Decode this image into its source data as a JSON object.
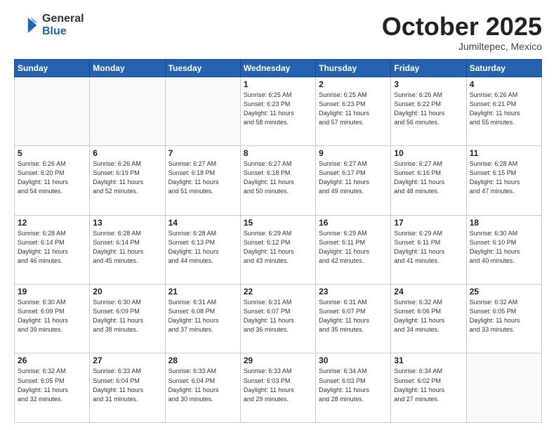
{
  "header": {
    "logo_general": "General",
    "logo_blue": "Blue",
    "month": "October 2025",
    "location": "Jumiltepec, Mexico"
  },
  "days_of_week": [
    "Sunday",
    "Monday",
    "Tuesday",
    "Wednesday",
    "Thursday",
    "Friday",
    "Saturday"
  ],
  "weeks": [
    [
      {
        "day": "",
        "info": ""
      },
      {
        "day": "",
        "info": ""
      },
      {
        "day": "",
        "info": ""
      },
      {
        "day": "1",
        "info": "Sunrise: 6:25 AM\nSunset: 6:23 PM\nDaylight: 11 hours\nand 58 minutes."
      },
      {
        "day": "2",
        "info": "Sunrise: 6:25 AM\nSunset: 6:23 PM\nDaylight: 11 hours\nand 57 minutes."
      },
      {
        "day": "3",
        "info": "Sunrise: 6:26 AM\nSunset: 6:22 PM\nDaylight: 11 hours\nand 56 minutes."
      },
      {
        "day": "4",
        "info": "Sunrise: 6:26 AM\nSunset: 6:21 PM\nDaylight: 11 hours\nand 55 minutes."
      }
    ],
    [
      {
        "day": "5",
        "info": "Sunrise: 6:26 AM\nSunset: 6:20 PM\nDaylight: 11 hours\nand 54 minutes."
      },
      {
        "day": "6",
        "info": "Sunrise: 6:26 AM\nSunset: 6:19 PM\nDaylight: 11 hours\nand 52 minutes."
      },
      {
        "day": "7",
        "info": "Sunrise: 6:27 AM\nSunset: 6:18 PM\nDaylight: 11 hours\nand 51 minutes."
      },
      {
        "day": "8",
        "info": "Sunrise: 6:27 AM\nSunset: 6:18 PM\nDaylight: 11 hours\nand 50 minutes."
      },
      {
        "day": "9",
        "info": "Sunrise: 6:27 AM\nSunset: 6:17 PM\nDaylight: 11 hours\nand 49 minutes."
      },
      {
        "day": "10",
        "info": "Sunrise: 6:27 AM\nSunset: 6:16 PM\nDaylight: 11 hours\nand 48 minutes."
      },
      {
        "day": "11",
        "info": "Sunrise: 6:28 AM\nSunset: 6:15 PM\nDaylight: 11 hours\nand 47 minutes."
      }
    ],
    [
      {
        "day": "12",
        "info": "Sunrise: 6:28 AM\nSunset: 6:14 PM\nDaylight: 11 hours\nand 46 minutes."
      },
      {
        "day": "13",
        "info": "Sunrise: 6:28 AM\nSunset: 6:14 PM\nDaylight: 11 hours\nand 45 minutes."
      },
      {
        "day": "14",
        "info": "Sunrise: 6:28 AM\nSunset: 6:13 PM\nDaylight: 11 hours\nand 44 minutes."
      },
      {
        "day": "15",
        "info": "Sunrise: 6:29 AM\nSunset: 6:12 PM\nDaylight: 11 hours\nand 43 minutes."
      },
      {
        "day": "16",
        "info": "Sunrise: 6:29 AM\nSunset: 6:11 PM\nDaylight: 11 hours\nand 42 minutes."
      },
      {
        "day": "17",
        "info": "Sunrise: 6:29 AM\nSunset: 6:11 PM\nDaylight: 11 hours\nand 41 minutes."
      },
      {
        "day": "18",
        "info": "Sunrise: 6:30 AM\nSunset: 6:10 PM\nDaylight: 11 hours\nand 40 minutes."
      }
    ],
    [
      {
        "day": "19",
        "info": "Sunrise: 6:30 AM\nSunset: 6:09 PM\nDaylight: 11 hours\nand 39 minutes."
      },
      {
        "day": "20",
        "info": "Sunrise: 6:30 AM\nSunset: 6:09 PM\nDaylight: 11 hours\nand 38 minutes."
      },
      {
        "day": "21",
        "info": "Sunrise: 6:31 AM\nSunset: 6:08 PM\nDaylight: 11 hours\nand 37 minutes."
      },
      {
        "day": "22",
        "info": "Sunrise: 6:31 AM\nSunset: 6:07 PM\nDaylight: 11 hours\nand 36 minutes."
      },
      {
        "day": "23",
        "info": "Sunrise: 6:31 AM\nSunset: 6:07 PM\nDaylight: 11 hours\nand 35 minutes."
      },
      {
        "day": "24",
        "info": "Sunrise: 6:32 AM\nSunset: 6:06 PM\nDaylight: 11 hours\nand 34 minutes."
      },
      {
        "day": "25",
        "info": "Sunrise: 6:32 AM\nSunset: 6:05 PM\nDaylight: 11 hours\nand 33 minutes."
      }
    ],
    [
      {
        "day": "26",
        "info": "Sunrise: 6:32 AM\nSunset: 6:05 PM\nDaylight: 11 hours\nand 32 minutes."
      },
      {
        "day": "27",
        "info": "Sunrise: 6:33 AM\nSunset: 6:04 PM\nDaylight: 11 hours\nand 31 minutes."
      },
      {
        "day": "28",
        "info": "Sunrise: 6:33 AM\nSunset: 6:04 PM\nDaylight: 11 hours\nand 30 minutes."
      },
      {
        "day": "29",
        "info": "Sunrise: 6:33 AM\nSunset: 6:03 PM\nDaylight: 11 hours\nand 29 minutes."
      },
      {
        "day": "30",
        "info": "Sunrise: 6:34 AM\nSunset: 6:03 PM\nDaylight: 11 hours\nand 28 minutes."
      },
      {
        "day": "31",
        "info": "Sunrise: 6:34 AM\nSunset: 6:02 PM\nDaylight: 11 hours\nand 27 minutes."
      },
      {
        "day": "",
        "info": ""
      }
    ]
  ]
}
